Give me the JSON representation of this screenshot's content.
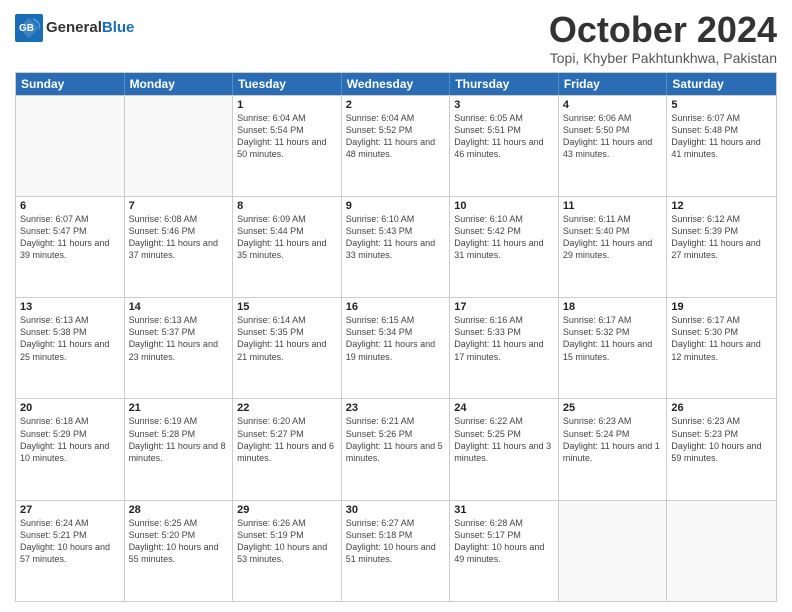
{
  "header": {
    "logo_line1": "General",
    "logo_line2": "Blue",
    "month": "October 2024",
    "location": "Topi, Khyber Pakhtunkhwa, Pakistan"
  },
  "weekdays": [
    "Sunday",
    "Monday",
    "Tuesday",
    "Wednesday",
    "Thursday",
    "Friday",
    "Saturday"
  ],
  "rows": [
    [
      {
        "day": "",
        "info": ""
      },
      {
        "day": "",
        "info": ""
      },
      {
        "day": "1",
        "info": "Sunrise: 6:04 AM\nSunset: 5:54 PM\nDaylight: 11 hours and 50 minutes."
      },
      {
        "day": "2",
        "info": "Sunrise: 6:04 AM\nSunset: 5:52 PM\nDaylight: 11 hours and 48 minutes."
      },
      {
        "day": "3",
        "info": "Sunrise: 6:05 AM\nSunset: 5:51 PM\nDaylight: 11 hours and 46 minutes."
      },
      {
        "day": "4",
        "info": "Sunrise: 6:06 AM\nSunset: 5:50 PM\nDaylight: 11 hours and 43 minutes."
      },
      {
        "day": "5",
        "info": "Sunrise: 6:07 AM\nSunset: 5:48 PM\nDaylight: 11 hours and 41 minutes."
      }
    ],
    [
      {
        "day": "6",
        "info": "Sunrise: 6:07 AM\nSunset: 5:47 PM\nDaylight: 11 hours and 39 minutes."
      },
      {
        "day": "7",
        "info": "Sunrise: 6:08 AM\nSunset: 5:46 PM\nDaylight: 11 hours and 37 minutes."
      },
      {
        "day": "8",
        "info": "Sunrise: 6:09 AM\nSunset: 5:44 PM\nDaylight: 11 hours and 35 minutes."
      },
      {
        "day": "9",
        "info": "Sunrise: 6:10 AM\nSunset: 5:43 PM\nDaylight: 11 hours and 33 minutes."
      },
      {
        "day": "10",
        "info": "Sunrise: 6:10 AM\nSunset: 5:42 PM\nDaylight: 11 hours and 31 minutes."
      },
      {
        "day": "11",
        "info": "Sunrise: 6:11 AM\nSunset: 5:40 PM\nDaylight: 11 hours and 29 minutes."
      },
      {
        "day": "12",
        "info": "Sunrise: 6:12 AM\nSunset: 5:39 PM\nDaylight: 11 hours and 27 minutes."
      }
    ],
    [
      {
        "day": "13",
        "info": "Sunrise: 6:13 AM\nSunset: 5:38 PM\nDaylight: 11 hours and 25 minutes."
      },
      {
        "day": "14",
        "info": "Sunrise: 6:13 AM\nSunset: 5:37 PM\nDaylight: 11 hours and 23 minutes."
      },
      {
        "day": "15",
        "info": "Sunrise: 6:14 AM\nSunset: 5:35 PM\nDaylight: 11 hours and 21 minutes."
      },
      {
        "day": "16",
        "info": "Sunrise: 6:15 AM\nSunset: 5:34 PM\nDaylight: 11 hours and 19 minutes."
      },
      {
        "day": "17",
        "info": "Sunrise: 6:16 AM\nSunset: 5:33 PM\nDaylight: 11 hours and 17 minutes."
      },
      {
        "day": "18",
        "info": "Sunrise: 6:17 AM\nSunset: 5:32 PM\nDaylight: 11 hours and 15 minutes."
      },
      {
        "day": "19",
        "info": "Sunrise: 6:17 AM\nSunset: 5:30 PM\nDaylight: 11 hours and 12 minutes."
      }
    ],
    [
      {
        "day": "20",
        "info": "Sunrise: 6:18 AM\nSunset: 5:29 PM\nDaylight: 11 hours and 10 minutes."
      },
      {
        "day": "21",
        "info": "Sunrise: 6:19 AM\nSunset: 5:28 PM\nDaylight: 11 hours and 8 minutes."
      },
      {
        "day": "22",
        "info": "Sunrise: 6:20 AM\nSunset: 5:27 PM\nDaylight: 11 hours and 6 minutes."
      },
      {
        "day": "23",
        "info": "Sunrise: 6:21 AM\nSunset: 5:26 PM\nDaylight: 11 hours and 5 minutes."
      },
      {
        "day": "24",
        "info": "Sunrise: 6:22 AM\nSunset: 5:25 PM\nDaylight: 11 hours and 3 minutes."
      },
      {
        "day": "25",
        "info": "Sunrise: 6:23 AM\nSunset: 5:24 PM\nDaylight: 11 hours and 1 minute."
      },
      {
        "day": "26",
        "info": "Sunrise: 6:23 AM\nSunset: 5:23 PM\nDaylight: 10 hours and 59 minutes."
      }
    ],
    [
      {
        "day": "27",
        "info": "Sunrise: 6:24 AM\nSunset: 5:21 PM\nDaylight: 10 hours and 57 minutes."
      },
      {
        "day": "28",
        "info": "Sunrise: 6:25 AM\nSunset: 5:20 PM\nDaylight: 10 hours and 55 minutes."
      },
      {
        "day": "29",
        "info": "Sunrise: 6:26 AM\nSunset: 5:19 PM\nDaylight: 10 hours and 53 minutes."
      },
      {
        "day": "30",
        "info": "Sunrise: 6:27 AM\nSunset: 5:18 PM\nDaylight: 10 hours and 51 minutes."
      },
      {
        "day": "31",
        "info": "Sunrise: 6:28 AM\nSunset: 5:17 PM\nDaylight: 10 hours and 49 minutes."
      },
      {
        "day": "",
        "info": ""
      },
      {
        "day": "",
        "info": ""
      }
    ]
  ]
}
